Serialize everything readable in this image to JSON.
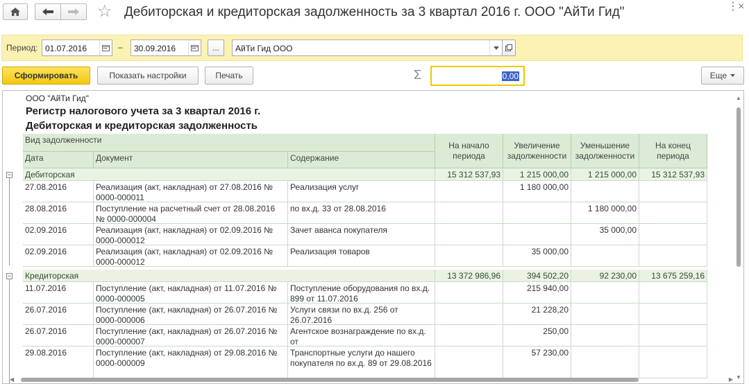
{
  "window": {
    "title": "Дебиторская и кредиторская задолженность за 3 квартал 2016 г. ООО \"АйТи Гид\"",
    "controls": [
      "⋮",
      "×"
    ]
  },
  "filters": {
    "period_label": "Период:",
    "date_from": "01.07.2016",
    "dash": "–",
    "date_to": "30.09.2016",
    "choose_label": "...",
    "organization": "АйТи Гид ООО"
  },
  "toolbar": {
    "generate_label": "Сформировать",
    "settings_label": "Показать настройки",
    "print_label": "Печать",
    "sigma": "Σ",
    "sum_value": "0,00",
    "more_label": "Еще"
  },
  "report": {
    "org": "ООО \"АйТи Гид\"",
    "title1": "Регистр налогового учета за 3 квартал 2016 г.",
    "title2": "Дебиторская и кредиторская задолженность",
    "headers": {
      "kind": "Вид задолженности",
      "date": "Дата",
      "document": "Документ",
      "content": "Содержание",
      "start": "На начало периода",
      "increase": "Увеличение задолженности",
      "decrease": "Уменьшение задолженности",
      "end": "На конец периода"
    },
    "groups": [
      {
        "name": "Дебиторская",
        "start": "15 312 537,93",
        "increase": "1 215 000,00",
        "decrease": "1 215 000,00",
        "end": "15 312 537,93",
        "rows": [
          {
            "date": "27.08.2016",
            "document": "Реализация (акт, накладная) от 27.08.2016 № 0000-000011",
            "content": "Реализация услуг",
            "start": "",
            "increase": "1 180 000,00",
            "decrease": "",
            "end": ""
          },
          {
            "date": "28.08.2016",
            "document": "Поступление на расчетный счет от 28.08.2016 № 0000-000004",
            "content": " по вх.д. 33 от 28.08.2016",
            "start": "",
            "increase": "",
            "decrease": "1 180 000,00",
            "end": ""
          },
          {
            "date": "02.09.2016",
            "document": "Реализация (акт, накладная) от 02.09.2016 № 0000-000012",
            "content": "Зачет аванса покупателя",
            "start": "",
            "increase": "",
            "decrease": "35 000,00",
            "end": ""
          },
          {
            "date": "02.09.2016",
            "document": "Реализация (акт, накладная) от 02.09.2016 № 0000-000012",
            "content": "Реализация товаров",
            "start": "",
            "increase": "35 000,00",
            "decrease": "",
            "end": ""
          }
        ]
      },
      {
        "name": "Кредиторская",
        "start": "13 372 986,96",
        "increase": "394 502,20",
        "decrease": "92 230,00",
        "end": "13 675 259,16",
        "rows": [
          {
            "date": "11.07.2016",
            "document": "Поступление (акт, накладная) от 11.07.2016 № 0000-000005",
            "content": "Поступление оборудования по вх.д. 899 от 11.07.2016",
            "start": "",
            "increase": "215 940,00",
            "decrease": "",
            "end": ""
          },
          {
            "date": "26.07.2016",
            "document": "Поступление (акт, накладная) от 26.07.2016 № 0000-000006",
            "content": "Услуги связи по вх.д. 256 от 26.07.2016",
            "start": "",
            "increase": "21 228,20",
            "decrease": "",
            "end": ""
          },
          {
            "date": "26.07.2016",
            "document": "Поступление (акт, накладная) от 26.07.2016 № 0000-000007",
            "content": "Агентское вознаграждение по вх.д. от",
            "start": "",
            "increase": "250,00",
            "decrease": "",
            "end": ""
          },
          {
            "date": "29.08.2016",
            "document": "Поступление (акт, накладная) от 29.08.2016 № 0000-000009",
            "content": "Транспортные услуги до нашего покупателя по вх.д. 89 от 29.08.2016",
            "start": "",
            "increase": "57 230,00",
            "decrease": "",
            "end": ""
          }
        ]
      }
    ]
  }
}
